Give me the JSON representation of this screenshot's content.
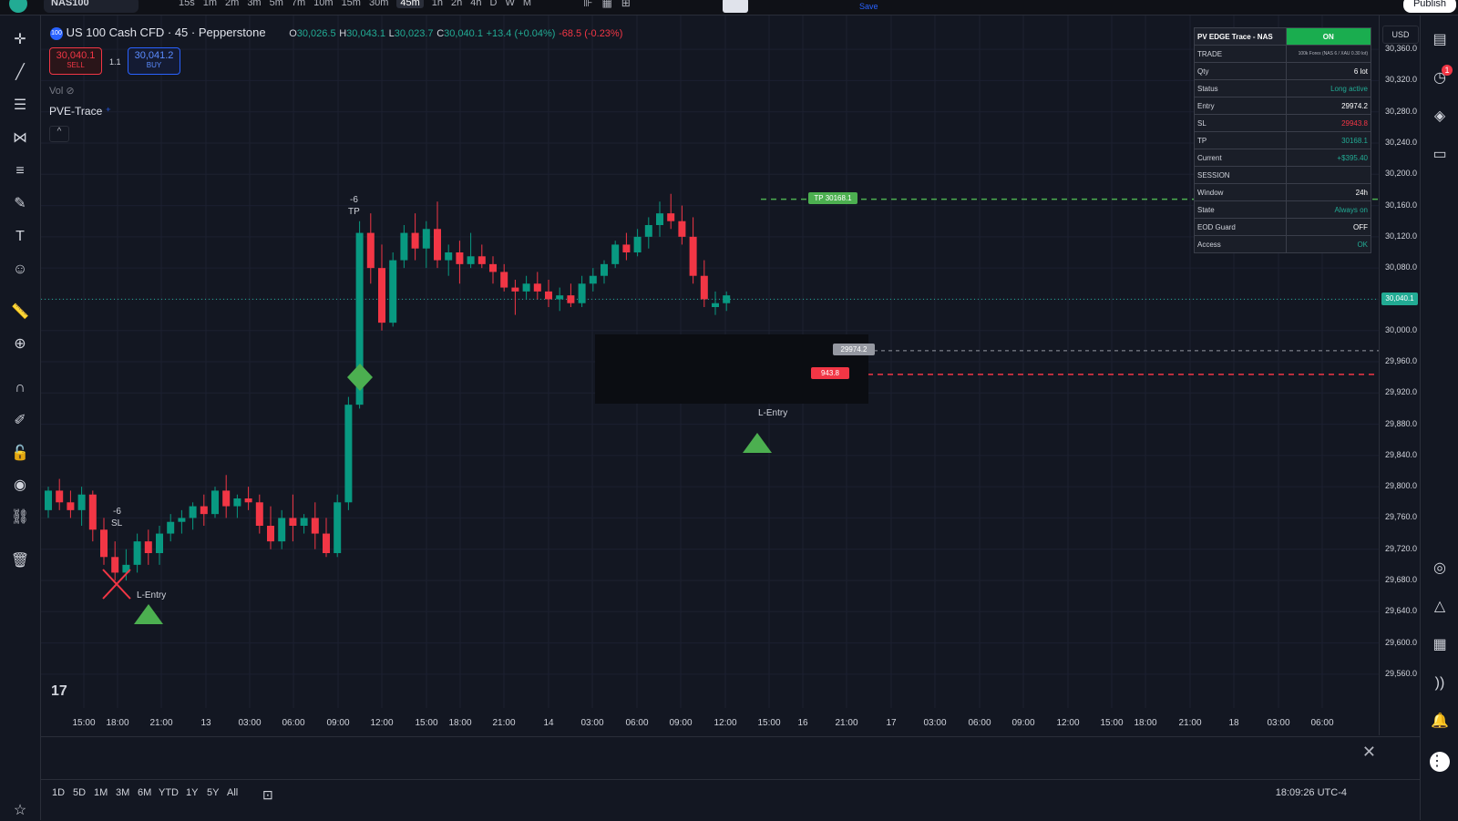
{
  "topbar": {
    "symbol": "NAS100",
    "timeframes": [
      "15s",
      "1m",
      "2m",
      "3m",
      "5m",
      "7m",
      "10m",
      "15m",
      "30m",
      "45m",
      "1h",
      "2h",
      "4h",
      "D",
      "W",
      "M"
    ],
    "active_timeframe": "45m",
    "save_label": "Save",
    "publish_label": "Publish"
  },
  "legend": {
    "badge": "100",
    "title": "US 100 Cash CFD · 45 · Pepperstone",
    "o_key": "O",
    "o_val": "30,026.5",
    "h_key": "H",
    "h_val": "30,043.1",
    "l_key": "L",
    "l_val": "30,023.7",
    "c_key": "C",
    "c_val": "30,040.1",
    "change": "+13.4 (+0.04%)",
    "change2": "-68.5 (-0.23%)"
  },
  "trade": {
    "sell_price": "30,040.1",
    "sell_label": "SELL",
    "buy_price": "30,041.2",
    "buy_label": "BUY",
    "spread": "1.1"
  },
  "vol_label": "Vol",
  "indicator_label": "PVE-Trace",
  "currency": "USD",
  "info_table": {
    "header_left": "PV EDGE Trace - NAS",
    "header_right": "ON",
    "rows": [
      {
        "k": "TRADE",
        "v": "100k Forex (NAS 6 / XAU 0.30 lot)",
        "c": "#b2b5be"
      },
      {
        "k": "Qty",
        "v": "6 lot",
        "c": "#ffffff"
      },
      {
        "k": "Status",
        "v": "Long active",
        "c": "#22ab94"
      },
      {
        "k": "Entry",
        "v": "29974.2",
        "c": "#ffffff"
      },
      {
        "k": "SL",
        "v": "29943.8",
        "c": "#f23645"
      },
      {
        "k": "TP",
        "v": "30168.1",
        "c": "#22ab94"
      },
      {
        "k": "Current",
        "v": "+$395.40",
        "c": "#22ab94"
      },
      {
        "k": "SESSION",
        "v": "",
        "c": "#ffffff"
      },
      {
        "k": "Window",
        "v": "24h",
        "c": "#ffffff"
      },
      {
        "k": "State",
        "v": "Always on",
        "c": "#22ab94"
      },
      {
        "k": "EOD Guard",
        "v": "OFF",
        "c": "#ffffff"
      },
      {
        "k": "Access",
        "v": "OK",
        "c": "#22ab94"
      }
    ]
  },
  "price_axis": {
    "ticks": [
      "30,360.0",
      "30,320.0",
      "30,280.0",
      "30,240.0",
      "30,200.0",
      "30,160.0",
      "30,120.0",
      "30,080.0",
      "30,040.0",
      "30,000.0",
      "29,960.0",
      "29,920.0",
      "29,880.0",
      "29,840.0",
      "29,800.0",
      "29,760.0",
      "29,720.0",
      "29,680.0",
      "29,640.0",
      "29,600.0",
      "29,560.0"
    ],
    "tick_values": [
      30360,
      30320,
      30280,
      30240,
      30200,
      30160,
      30120,
      30080,
      30040,
      30000,
      29960,
      29920,
      29880,
      29840,
      29800,
      29760,
      29720,
      29680,
      29640,
      29600,
      29560
    ],
    "current_price": "30,040.1",
    "tp_label": "TP 30168.1",
    "entry_label": "29974.2",
    "sl_label": "943.8"
  },
  "time_axis": [
    "15:00",
    "18:00",
    "21:00",
    "13",
    "03:00",
    "06:00",
    "09:00",
    "12:00",
    "15:00",
    "18:00",
    "21:00",
    "14",
    "03:00",
    "06:00",
    "09:00",
    "12:00",
    "15:00",
    "16",
    "21:00",
    "17",
    "03:00",
    "06:00",
    "09:00",
    "12:00",
    "15:00",
    "18:00",
    "21:00",
    "18",
    "03:00",
    "06:00"
  ],
  "markers": {
    "tp_count": "-6",
    "tp_text": "TP",
    "sl_count": "-6",
    "sl_text": "SL",
    "entry1": "L-Entry",
    "entry2": "L-Entry"
  },
  "chart_data": {
    "type": "candlestick",
    "title": "US 100 Cash CFD · 45 · Pepperstone",
    "ylim": [
      29540,
      30380
    ],
    "ohlc": [
      [
        29770,
        29800,
        29760,
        29795
      ],
      [
        29795,
        29810,
        29770,
        29780
      ],
      [
        29780,
        29795,
        29760,
        29770
      ],
      [
        29770,
        29800,
        29750,
        29790
      ],
      [
        29790,
        29795,
        29730,
        29745
      ],
      [
        29745,
        29760,
        29700,
        29710
      ],
      [
        29710,
        29730,
        29680,
        29690
      ],
      [
        29690,
        29720,
        29680,
        29700
      ],
      [
        29700,
        29740,
        29690,
        29730
      ],
      [
        29730,
        29745,
        29700,
        29715
      ],
      [
        29715,
        29750,
        29700,
        29740
      ],
      [
        29740,
        29765,
        29730,
        29755
      ],
      [
        29755,
        29770,
        29740,
        29760
      ],
      [
        29760,
        29780,
        29745,
        29775
      ],
      [
        29775,
        29790,
        29750,
        29765
      ],
      [
        29765,
        29800,
        29760,
        29795
      ],
      [
        29795,
        29815,
        29760,
        29775
      ],
      [
        29775,
        29790,
        29760,
        29785
      ],
      [
        29785,
        29800,
        29770,
        29780
      ],
      [
        29780,
        29790,
        29740,
        29750
      ],
      [
        29750,
        29775,
        29720,
        29730
      ],
      [
        29730,
        29770,
        29720,
        29760
      ],
      [
        29760,
        29790,
        29730,
        29750
      ],
      [
        29750,
        29765,
        29740,
        29760
      ],
      [
        29760,
        29780,
        29720,
        29740
      ],
      [
        29740,
        29760,
        29710,
        29715
      ],
      [
        29715,
        29790,
        29710,
        29780
      ],
      [
        29780,
        29915,
        29770,
        29905
      ],
      [
        29905,
        30140,
        29900,
        30125
      ],
      [
        30125,
        30150,
        30060,
        30080
      ],
      [
        30080,
        30110,
        30000,
        30010
      ],
      [
        30010,
        30100,
        30005,
        30090
      ],
      [
        30090,
        30135,
        30080,
        30125
      ],
      [
        30125,
        30150,
        30090,
        30105
      ],
      [
        30105,
        30140,
        30080,
        30130
      ],
      [
        30130,
        30165,
        30080,
        30090
      ],
      [
        30090,
        30110,
        30070,
        30100
      ],
      [
        30100,
        30115,
        30060,
        30085
      ],
      [
        30085,
        30125,
        30080,
        30095
      ],
      [
        30095,
        30110,
        30080,
        30085
      ],
      [
        30085,
        30095,
        30060,
        30075
      ],
      [
        30075,
        30085,
        30050,
        30055
      ],
      [
        30055,
        30065,
        30020,
        30050
      ],
      [
        30050,
        30070,
        30040,
        30060
      ],
      [
        30060,
        30075,
        30040,
        30050
      ],
      [
        30050,
        30065,
        30030,
        30040
      ],
      [
        30040,
        30055,
        30025,
        30045
      ],
      [
        30045,
        30060,
        30030,
        30035
      ],
      [
        30035,
        30070,
        30030,
        30060
      ],
      [
        30060,
        30080,
        30050,
        30070
      ],
      [
        30070,
        30090,
        30060,
        30085
      ],
      [
        30085,
        30115,
        30080,
        30110
      ],
      [
        30110,
        30125,
        30090,
        30100
      ],
      [
        30100,
        30130,
        30095,
        30120
      ],
      [
        30120,
        30145,
        30105,
        30135
      ],
      [
        30135,
        30165,
        30120,
        30150
      ],
      [
        30150,
        30175,
        30130,
        30140
      ],
      [
        30140,
        30160,
        30110,
        30120
      ],
      [
        30120,
        30145,
        30060,
        30070
      ],
      [
        30070,
        30090,
        30030,
        30040
      ],
      [
        30030,
        30050,
        30020,
        30035
      ],
      [
        30035,
        30050,
        30025,
        30045
      ]
    ],
    "tp": 30168.1,
    "entry": 29974.2,
    "sl": 29943.8,
    "current": 30040.1
  },
  "bottom": {
    "ranges": [
      "1D",
      "5D",
      "1M",
      "3M",
      "6M",
      "YTD",
      "1Y",
      "5Y",
      "All"
    ],
    "clock": "18:09:26 UTC-4"
  }
}
